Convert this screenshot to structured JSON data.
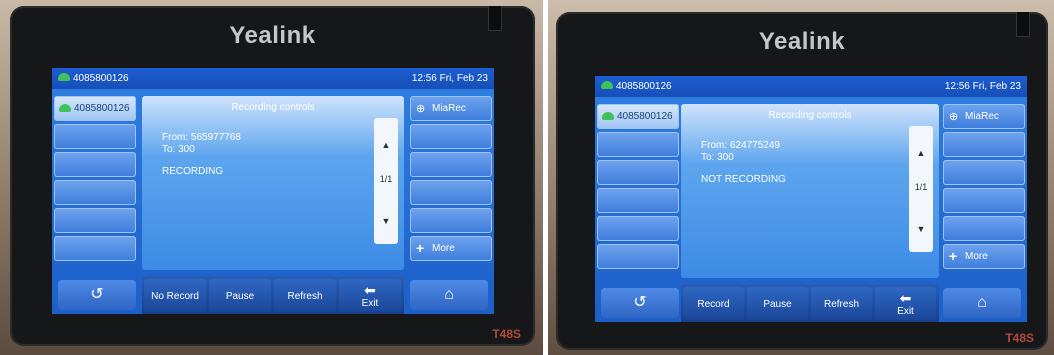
{
  "left": {
    "brand": "Yealink",
    "model": "T48S",
    "status_bar": {
      "account": "4085800126",
      "datetime": "12:56 Fri, Feb 23"
    },
    "line_key": "4085800126",
    "panel": {
      "title": "Recording controls",
      "from": "From: 565977768",
      "to": "To: 300",
      "state": "RECORDING",
      "page": "1/1"
    },
    "right_keys": {
      "miarec": "MiaRec",
      "more": "More"
    },
    "softkeys": [
      "No Record",
      "Pause",
      "Refresh",
      "Exit"
    ]
  },
  "right": {
    "brand": "Yealink",
    "model": "T48S",
    "status_bar": {
      "account": "4085800126",
      "datetime": "12:56 Fri, Feb 23"
    },
    "line_key": "4085800126",
    "panel": {
      "title": "Recording controls",
      "from": "From: 624775249",
      "to": "To: 300",
      "state": "NOT RECORDING",
      "page": "1/1"
    },
    "right_keys": {
      "miarec": "MiaRec",
      "more": "More"
    },
    "softkeys": [
      "Record",
      "Pause",
      "Refresh",
      "Exit"
    ]
  },
  "colors": {
    "screen_blue": "#2f7fe2",
    "bezel": "#151719",
    "phone_green": "#3fc25a",
    "model_red": "#b04a3c"
  }
}
